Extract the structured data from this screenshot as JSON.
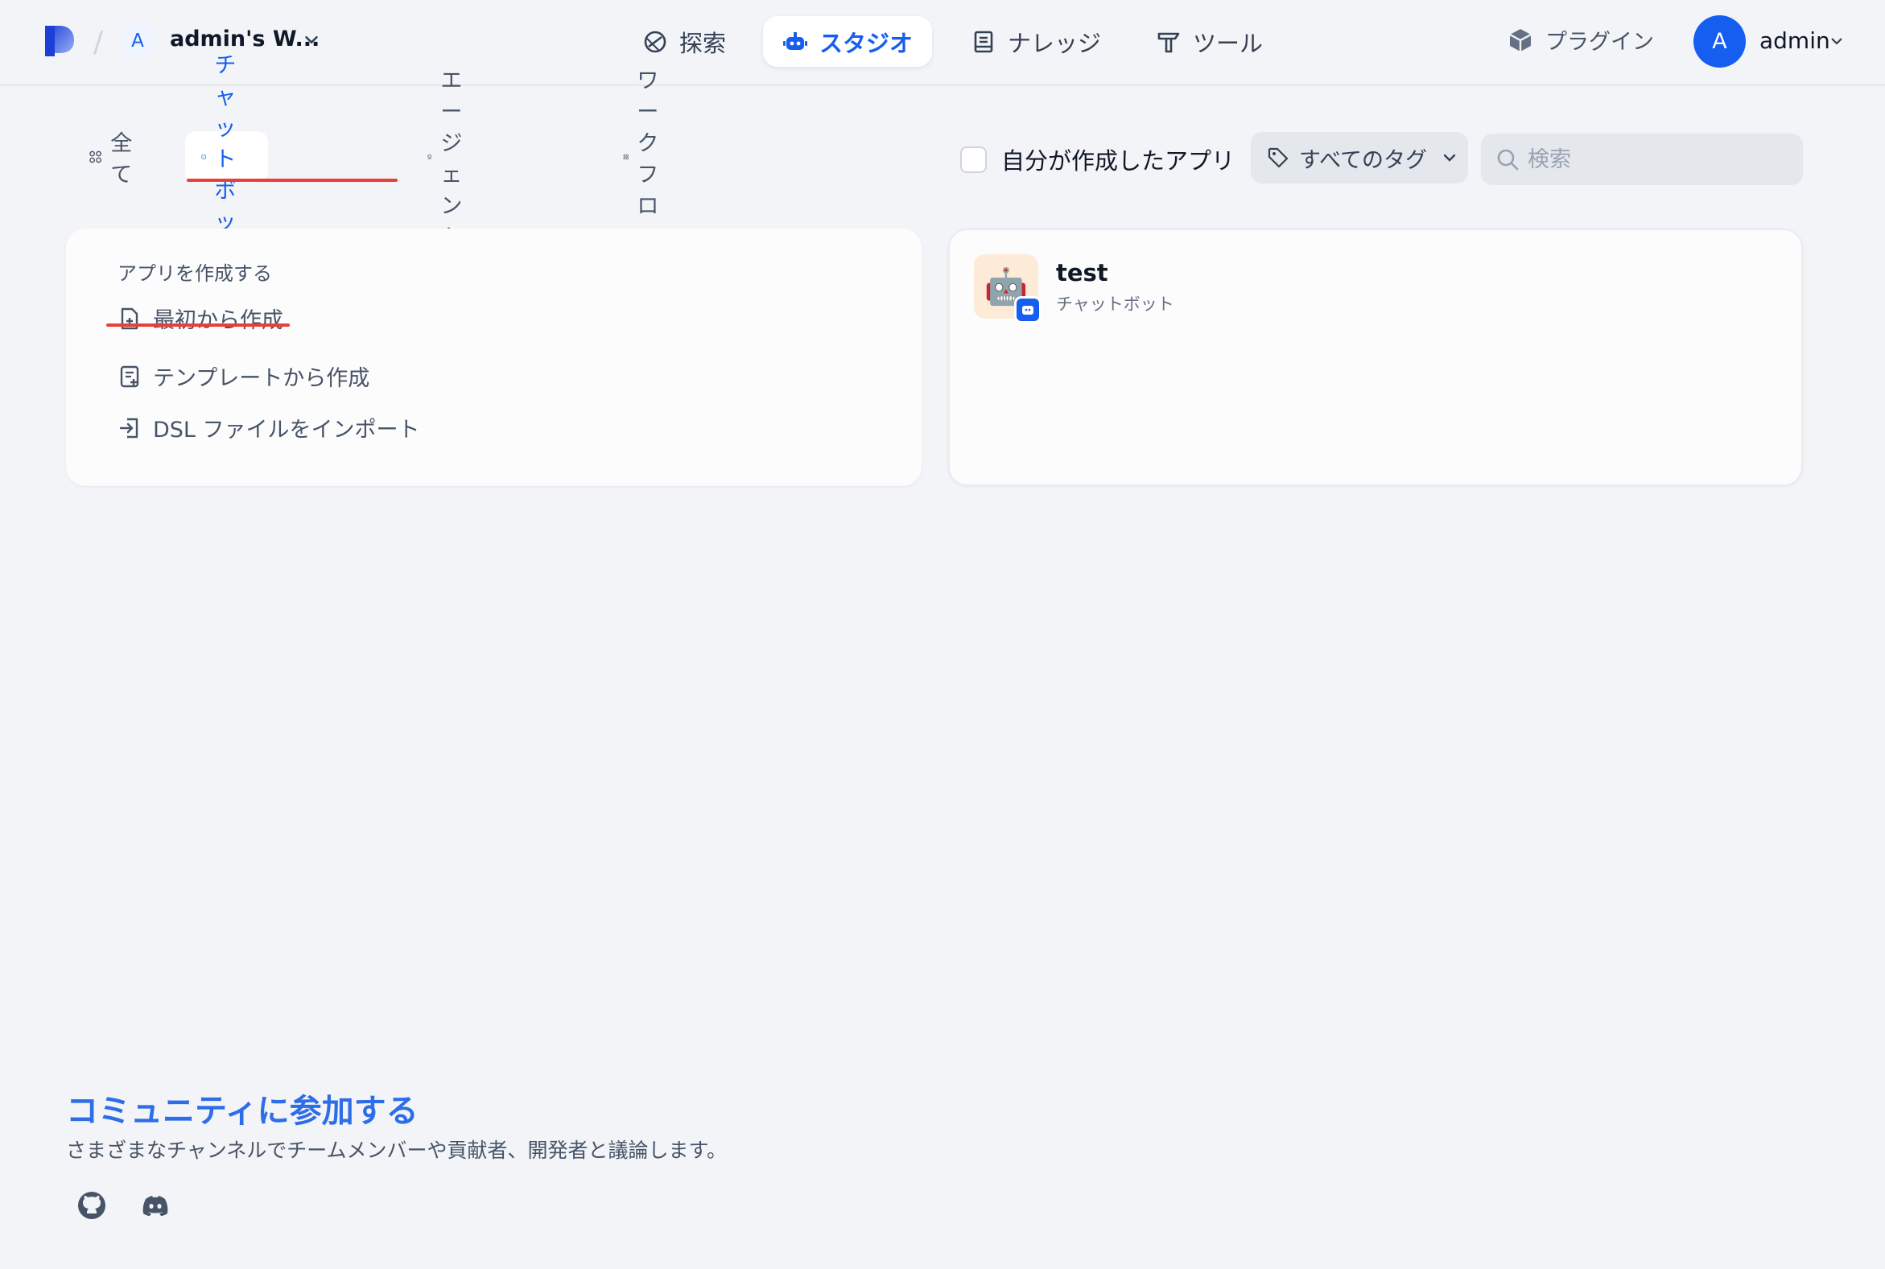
{
  "header": {
    "workspace_initial": "A",
    "workspace_name": "admin's W...",
    "nav": [
      {
        "label": "探索",
        "icon": "compass-icon"
      },
      {
        "label": "スタジオ",
        "icon": "robot-icon",
        "active": true
      },
      {
        "label": "ナレッジ",
        "icon": "book-icon"
      },
      {
        "label": "ツール",
        "icon": "hammer-icon"
      }
    ],
    "plugin_label": "プラグイン",
    "user_initial": "A",
    "user_name": "admin"
  },
  "filters": {
    "tabs": [
      {
        "label": "全て",
        "icon": "grid-icon"
      },
      {
        "label": "チャットボット",
        "icon": "chat-bot-icon",
        "active": true
      },
      {
        "label": "エージェント",
        "icon": "agent-icon"
      },
      {
        "label": "ワークフロー",
        "icon": "workflow-icon"
      }
    ],
    "my_apps_label": "自分が作成したアプリ",
    "tags_label": "すべてのタグ",
    "search_placeholder": "検索"
  },
  "create": {
    "title": "アプリを作成する",
    "items": [
      {
        "label": "最初から作成",
        "icon": "new-file-icon"
      },
      {
        "label": "テンプレートから作成",
        "icon": "template-icon"
      },
      {
        "label": "DSL ファイルをインポート",
        "icon": "import-icon"
      }
    ]
  },
  "apps": [
    {
      "name": "test",
      "type": "チャットボット",
      "emoji": "🤖"
    }
  ],
  "community": {
    "title": "コミュニティに参加する",
    "description": "さまざまなチャンネルでチームメンバーや貢献者、開発者と議論します。"
  },
  "colors": {
    "accent": "#155eef",
    "highlight": "#e5403a",
    "background": "#f2f4f7"
  }
}
